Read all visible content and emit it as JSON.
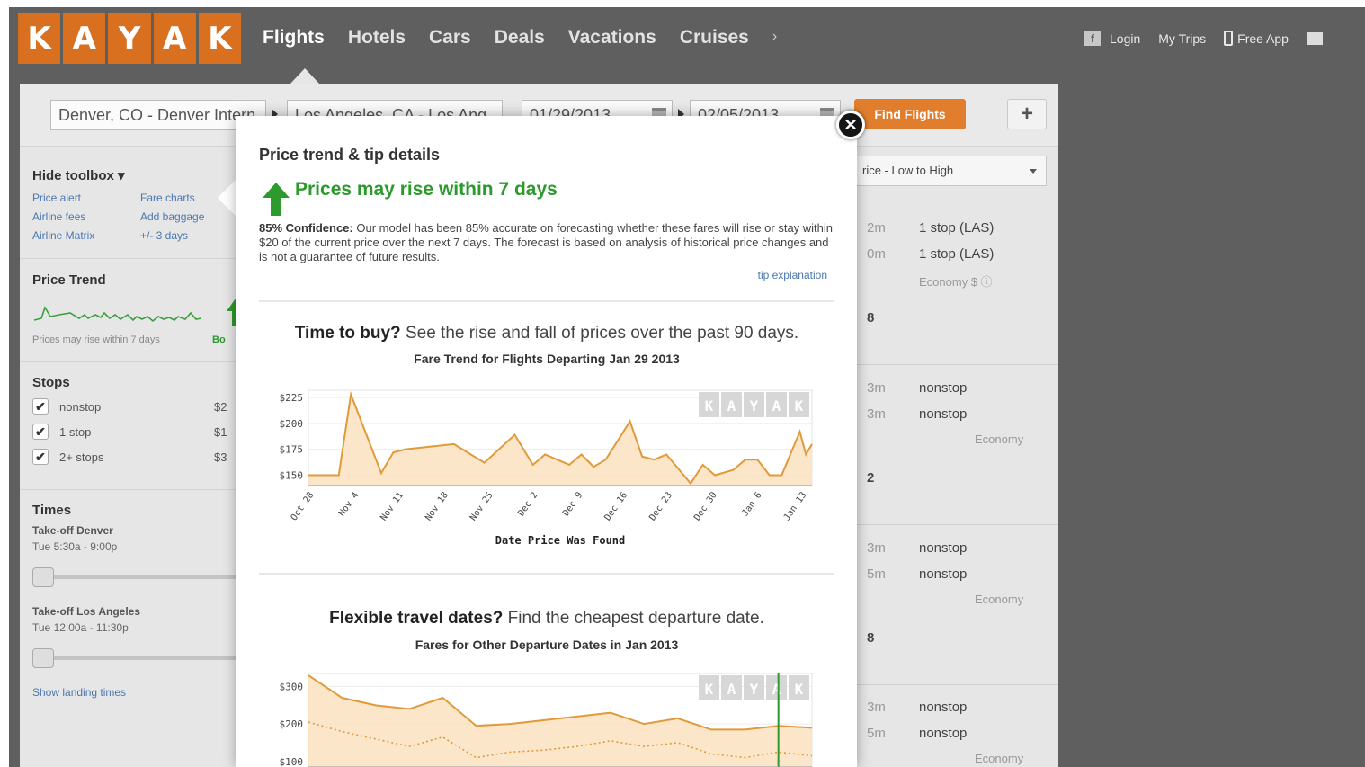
{
  "header": {
    "logo_letters": [
      "K",
      "A",
      "Y",
      "A",
      "K"
    ],
    "nav": [
      "Flights",
      "Hotels",
      "Cars",
      "Deals",
      "Vacations",
      "Cruises"
    ],
    "nav_more": "›",
    "login": "Login",
    "my_trips": "My Trips",
    "free_app": "Free App",
    "facebook_icon_glyph": "f"
  },
  "search": {
    "origin": "Denver, CO - Denver Intern",
    "destination": "Los Angeles, CA - Los Ang",
    "depart_date": "01/29/2013",
    "return_date": "02/05/2013",
    "find_button": "Find Flights",
    "add_button": "+"
  },
  "toolbox": {
    "hide_label": "Hide toolbox ▾",
    "links": [
      [
        "Price alert",
        "Fare charts"
      ],
      [
        "Airline fees",
        "Add baggage"
      ],
      [
        "Airline Matrix",
        "+/- 3 days"
      ]
    ],
    "price_trend_heading": "Price Trend",
    "price_trend_caption": "Prices may rise within 7 days",
    "price_trend_buy": "Bo",
    "stops_heading": "Stops",
    "stops": [
      {
        "label": "nonstop",
        "price": "$2"
      },
      {
        "label": "1 stop",
        "price": "$1"
      },
      {
        "label": "2+ stops",
        "price": "$3"
      }
    ],
    "times_heading": "Times",
    "takeoff_denver_label": "Take-off Denver",
    "takeoff_denver_range": "Tue 5:30a - 9:00p",
    "takeoff_la_label": "Take-off Los Angeles",
    "takeoff_la_range": "Tue 12:00a - 11:30p",
    "show_landing": "Show landing times"
  },
  "results": {
    "sort_label": "rice - Low to High",
    "r1a_dur": "2m",
    "r1a_stop": "1 stop (LAS)",
    "r1b_dur": "0m",
    "r1b_stop": "1 stop (LAS)",
    "r1_class": "Economy  $  ⓘ",
    "r1_count": "8",
    "r2a_dur": "3m",
    "r2a_stop": "nonstop",
    "r2b_dur": "3m",
    "r2b_stop": "nonstop",
    "r2_class": "Economy",
    "r2_count": "2",
    "r3a_dur": "3m",
    "r3a_stop": "nonstop",
    "r3b_dur": "5m",
    "r3b_stop": "nonstop",
    "r3_class": "Economy",
    "r3_count": "8",
    "r4a_dur": "3m",
    "r4a_stop": "nonstop",
    "r4b_dur": "5m",
    "r4b_stop": "nonstop",
    "r4_class": "Economy"
  },
  "overlay": {
    "title": "Price trend & tip details",
    "headline": "Prices may rise within 7 days",
    "confidence_label": "85% Confidence:",
    "confidence_text": " Our model has been 85% accurate on forecasting whether these fares will rise or stay within $20 of the current price over the next 7 days. The forecast is based on analysis of historical price changes and is not a guarantee of future results.",
    "tip_link": "tip explanation",
    "sec1_bold": "Time to buy?",
    "sec1_rest": " See the rise and fall of prices over the past 90 days.",
    "sec2_bold": "Flexible travel dates?",
    "sec2_rest": " Find the cheapest departure date.",
    "close_glyph": "✕"
  },
  "colors": {
    "brand_orange": "#d9701f",
    "line_orange": "#e09a3a",
    "fill_orange": "#fbe2c1",
    "green": "#2c9a2c",
    "link_blue": "#4a78b0"
  },
  "chart_data": [
    {
      "type": "area",
      "title": "Fare Trend for Flights Departing Jan 29 2013",
      "xlabel": "Date Price Was Found",
      "ylabel": "",
      "ylim": [
        140,
        232
      ],
      "yticks": [
        "$225",
        "$200",
        "$175",
        "$150"
      ],
      "ytick_values": [
        225,
        200,
        175,
        150
      ],
      "xticks": [
        "Oct 28",
        "Nov 4",
        "Nov 11",
        "Nov 18",
        "Nov 25",
        "Dec 2",
        "Dec 9",
        "Dec 16",
        "Dec 23",
        "Dec 30",
        "Jan 6",
        "Jan 13"
      ],
      "x_range": [
        0,
        83
      ],
      "watermark": "KAYAK",
      "series": [
        {
          "x": [
            0,
            5,
            7,
            12,
            14,
            16,
            24,
            29,
            34,
            37,
            39,
            43,
            45,
            47,
            49,
            53,
            55,
            57,
            59,
            63,
            65,
            67,
            70,
            72,
            74,
            76,
            78,
            81,
            82,
            83
          ],
          "values": [
            150,
            150,
            228,
            152,
            172,
            175,
            180,
            162,
            189,
            160,
            170,
            160,
            170,
            158,
            165,
            202,
            168,
            165,
            170,
            142,
            160,
            150,
            155,
            165,
            165,
            150,
            150,
            192,
            170,
            180
          ]
        }
      ]
    },
    {
      "type": "area",
      "title": "Fares for Other Departure Dates in Jan 2013",
      "xlabel": "",
      "ylabel": "",
      "ylim": [
        85,
        335
      ],
      "yticks": [
        "$300",
        "$200",
        "$100"
      ],
      "ytick_values": [
        300,
        200,
        100
      ],
      "x_range": [
        0,
        30
      ],
      "watermark": "KAYAK",
      "highlight_x": 28,
      "series": [
        {
          "x": [
            0,
            2,
            4,
            6,
            8,
            10,
            12,
            14,
            16,
            18,
            20,
            22,
            24,
            26,
            28,
            30
          ],
          "values": [
            330,
            270,
            250,
            240,
            270,
            195,
            200,
            210,
            220,
            230,
            200,
            215,
            185,
            185,
            195,
            190
          ]
        },
        {
          "x": [
            0,
            2,
            4,
            6,
            8,
            10,
            12,
            14,
            16,
            18,
            20,
            22,
            24,
            26,
            28,
            30
          ],
          "values": [
            205,
            180,
            160,
            140,
            165,
            110,
            125,
            130,
            140,
            155,
            140,
            150,
            120,
            110,
            125,
            115
          ]
        }
      ]
    }
  ]
}
